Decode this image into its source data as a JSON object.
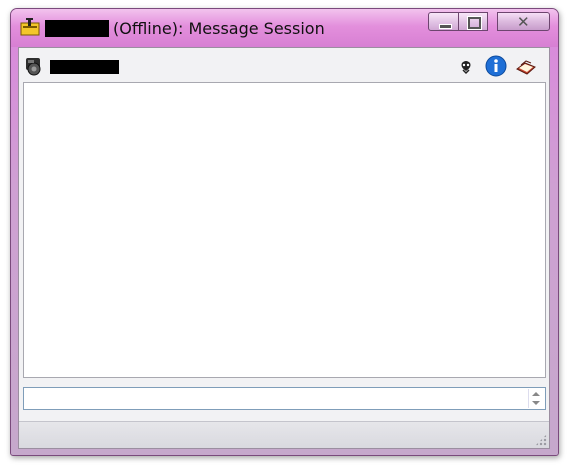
{
  "window": {
    "title": "(Offline): Message Session",
    "controls": {
      "minimize": "minimize",
      "maximize": "maximize",
      "close": "close"
    }
  },
  "toolbar": {
    "icons": [
      "emoticons-icon",
      "info-icon",
      "address-book-icon"
    ]
  },
  "chat": {
    "messages": []
  },
  "input": {
    "value": "",
    "placeholder": ""
  },
  "colors": {
    "title_accent": "#d77fd3",
    "info_icon": "#1f6fd6"
  }
}
